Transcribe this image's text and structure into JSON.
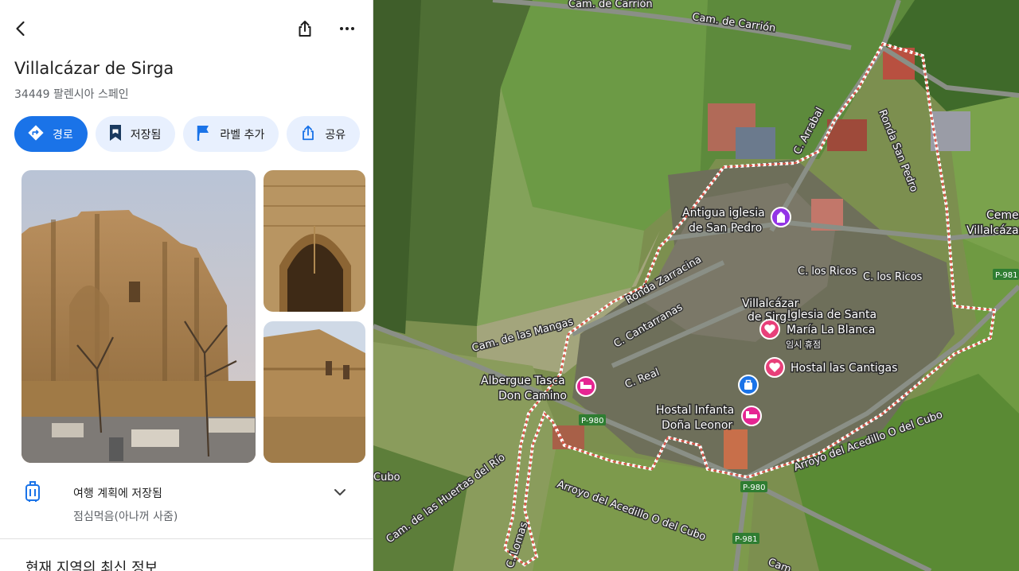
{
  "place": {
    "title": "Villalcázar de Sirga",
    "address": "34449 팔렌시아 스페인"
  },
  "icons": {
    "back": "back-arrow-icon",
    "share": "share-icon",
    "more": "more-vert-icon"
  },
  "actions": [
    {
      "label": "경로",
      "icon": "directions-icon",
      "primary": true
    },
    {
      "label": "저장됨",
      "icon": "bookmark-icon",
      "primary": false
    },
    {
      "label": "라벨 추가",
      "icon": "flag-icon",
      "primary": false
    },
    {
      "label": "공유",
      "icon": "share-icon",
      "primary": false
    }
  ],
  "trip": {
    "title": "여행 계획에 저장됨",
    "subtitle": "점심먹음(아나꺼 사줌)",
    "icon": "luggage-icon"
  },
  "section": {
    "title": "현재 지역의 최신 정보"
  },
  "map": {
    "streets": [
      "Cam. de Carrión",
      "Cam. de Carrión",
      "C. Arrabal",
      "Ronda San Pedro",
      "Ronda Zarracina",
      "C. Cantarranas",
      "C. Real",
      "C. los Ricos",
      "C. los Ricos",
      "Cam. de las Mangas",
      "Cam. de las Huertas del Río",
      "Arroyo del Acedillo O del Cubo",
      "Arroyo del Acedillo O del Cubo",
      "Cubo",
      "Cam.",
      "C. Lomas"
    ],
    "roads": [
      "P-981",
      "P-980",
      "P-980",
      "P-981"
    ],
    "pois": [
      {
        "name": "Antigua iglesia de San Pedro",
        "type": "church-icon",
        "color": "#9334e6"
      },
      {
        "name": "Iglesia de Santa María La Blanca",
        "type": "heart-icon",
        "color": "#e8407a",
        "status": "임시 휴점"
      },
      {
        "name": "Hostal las Cantigas",
        "type": "heart-icon",
        "color": "#e8407a"
      },
      {
        "name": "Albergue Tasca Don Camino",
        "type": "hotel-icon",
        "color": "#e52592"
      },
      {
        "name": "Hostal Infanta Doña Leonor",
        "type": "hotel-icon",
        "color": "#e52592"
      },
      {
        "name": "",
        "type": "shopping-bag-icon",
        "color": "#1a73e8"
      }
    ],
    "town_label": "Villalcázar de Sirga",
    "poi_edge_label": "Ceme Villalcázar"
  }
}
